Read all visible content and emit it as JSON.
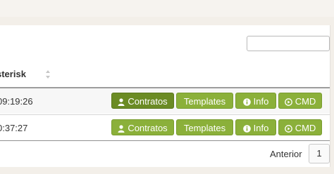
{
  "table": {
    "column_header": "sterisk",
    "rows": [
      {
        "time": "09:19:26"
      },
      {
        "time": "0:37:27"
      }
    ]
  },
  "actions": {
    "contratos": "Contratos",
    "templates": "Templates",
    "info": "Info",
    "cmd": "CMD"
  },
  "pagination": {
    "previous": "Anterior",
    "current_page": "1"
  },
  "icons": {
    "contratos": "user-icon",
    "info": "info-circle-icon",
    "cmd": "play-circle-icon",
    "sort": "sort-icon"
  },
  "colors": {
    "button_green": "#8bb03a",
    "button_green_active": "#6b8b24"
  }
}
